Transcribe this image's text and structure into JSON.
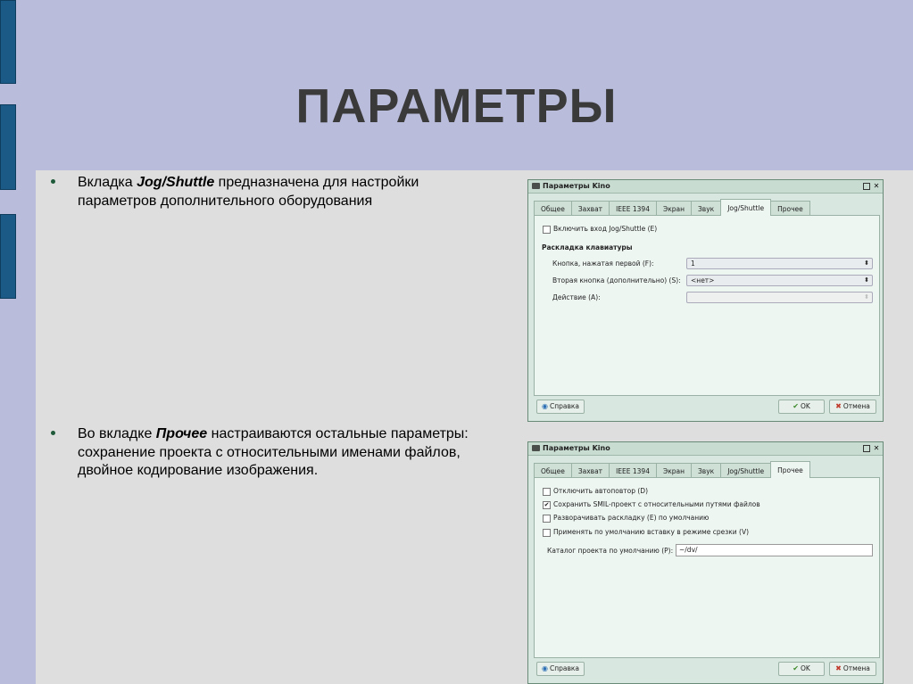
{
  "slide": {
    "title": "ПАРАМЕТРЫ",
    "bullet1": {
      "pre": "Вкладка ",
      "em": "Jog/Shuttle",
      "post": " предназначена для настройки параметров дополнительного оборудования"
    },
    "bullet2": {
      "pre": "Во вкладке ",
      "em": "Прочее",
      "post": " настраиваются остальные параметры: сохранение проекта с относительными именами файлов, двойное кодирование изображения."
    }
  },
  "window1": {
    "title": "Параметры Kino",
    "tabs": [
      "Общее",
      "Захват",
      "IEEE 1394",
      "Экран",
      "Звук",
      "Jog/Shuttle",
      "Прочее"
    ],
    "active_tab": "Jog/Shuttle",
    "enable_label": "Включить вход Jog/Shuttle (E)",
    "section": "Раскладка клавиатуры",
    "first_label": "Кнопка, нажатая первой (F):",
    "first_value": "1",
    "second_label": "Вторая кнопка (дополнительно) (S):",
    "second_value": "<нет>",
    "action_label": "Действие (A):",
    "action_value": "",
    "help": "Справка",
    "ok": "OK",
    "cancel": "Отмена"
  },
  "window2": {
    "title": "Параметры Kino",
    "tabs": [
      "Общее",
      "Захват",
      "IEEE 1394",
      "Экран",
      "Звук",
      "Jog/Shuttle",
      "Прочее"
    ],
    "active_tab": "Прочее",
    "options": [
      {
        "label": "Отключить автоповтор (D)",
        "checked": false
      },
      {
        "label": "Сохранить SMIL-проект с относительными путями файлов",
        "checked": true
      },
      {
        "label": "Разворачивать раскладку (E) по умолчанию",
        "checked": false
      },
      {
        "label": "Применять по умолчанию вставку в режиме срезки (V)",
        "checked": false
      }
    ],
    "dir_label": "Каталог проекта по умолчанию (P):",
    "dir_value": "~/dv/",
    "help": "Справка",
    "ok": "OK",
    "cancel": "Отмена"
  },
  "icons": {
    "check": "✔",
    "help": "help-icon",
    "ok": "check-icon",
    "cancel": "cross-icon"
  },
  "colors": {
    "background": "#b9bcda",
    "content": "#dedede",
    "accent": "#1b5a86",
    "window": "#d8e7df"
  }
}
